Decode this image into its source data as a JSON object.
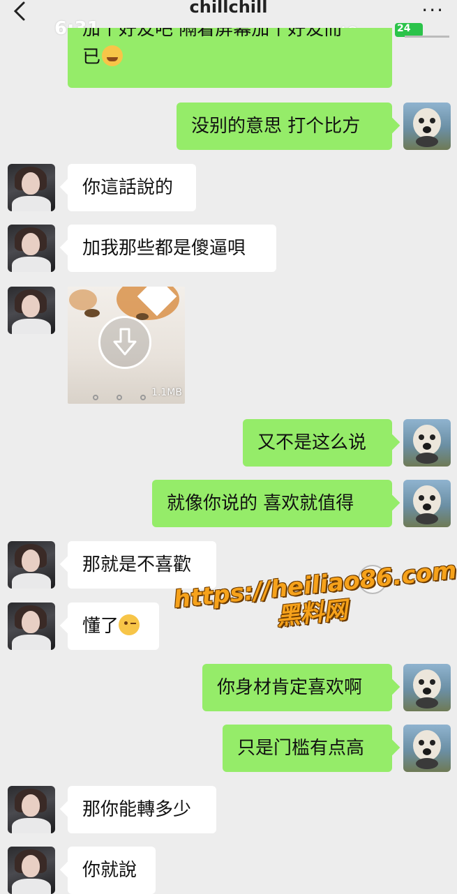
{
  "status": {
    "time": "6:31",
    "network": "4G",
    "battery": "24"
  },
  "header": {
    "title": "chillchill",
    "more_icon": "more-dots-icon",
    "back_icon": "chevron-left-icon"
  },
  "messages": [
    {
      "from": "me",
      "text": "加个好友吧 隔着屏幕加个好友而已",
      "line1": "加个好友吧 隔着屏幕加个好友而",
      "line2": "已"
    },
    {
      "from": "me",
      "text": "没别的意思 打个比方"
    },
    {
      "from": "other",
      "text": "你這話說的"
    },
    {
      "from": "other",
      "text": "加我那些都是傻逼唄"
    },
    {
      "from": "other",
      "type": "image",
      "size": "1.1MB"
    },
    {
      "from": "me",
      "text": "又不是这么说"
    },
    {
      "from": "me",
      "text": "就像你说的  喜欢就值得"
    },
    {
      "from": "other",
      "text": "那就是不喜歡"
    },
    {
      "from": "other",
      "text": "懂了"
    },
    {
      "from": "me",
      "text": "你身材肯定喜欢啊"
    },
    {
      "from": "me",
      "text": "只是门槛有点高"
    },
    {
      "from": "other",
      "text": "那你能轉多少"
    },
    {
      "from": "other",
      "text": "你就說"
    }
  ],
  "watermark": {
    "url": "https://heiliao86.com",
    "cn": "黑料网"
  },
  "colors": {
    "outgoing": "#95ec69",
    "incoming": "#ffffff",
    "background": "#ededed"
  }
}
